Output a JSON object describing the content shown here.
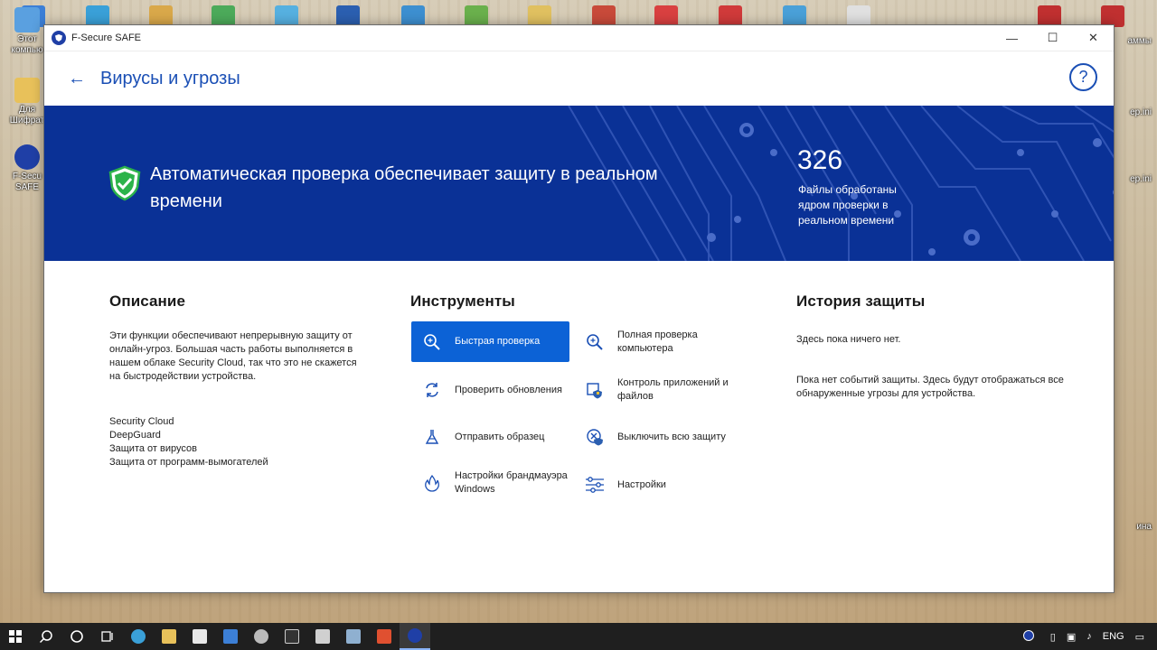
{
  "desktop": {
    "left_icons": [
      {
        "label": "Этот компью",
        "color": "#5aa0e0"
      },
      {
        "label": "Для Шифрат",
        "color": "#e8c15a"
      },
      {
        "label": "F-Secu SAFE",
        "color": "#1f3fa6"
      }
    ],
    "right_labels": [
      "аммы",
      "ep.ini",
      "ep.ini",
      "ина"
    ],
    "top_icon_colors": [
      "#3c7fd6",
      "#3aa0d8",
      "#d9a84a",
      "#4caa5a",
      "#56b0e0",
      "#2b5fb0",
      "#3d8fd0",
      "#6ab04c",
      "#e0c060",
      "#c84a3a",
      "#d94040",
      "#d03a3a",
      "#4aa0d8",
      "#e0e0e0",
      "#c03030"
    ]
  },
  "window": {
    "title": "F-Secure SAFE",
    "controls": {
      "minimize": "—",
      "maximize": "☐",
      "close": "✕"
    }
  },
  "header": {
    "back_icon": "←",
    "title": "Вирусы и угрозы",
    "help_icon": "?"
  },
  "banner": {
    "status_text": "Автоматическая проверка обеспечивает защиту в реальном времени",
    "stat_value": "326",
    "stat_label": "Файлы обработаны ядром проверки в реальном времени",
    "colors": {
      "background": "#0a3196",
      "shield": "#2cb34a"
    }
  },
  "description": {
    "title": "Описание",
    "text": "Эти функции обеспечивают непрерывную защиту от онлайн-угроз. Большая часть работы выполняется в нашем облаке Security Cloud, так что это не скажется на быстродействии устройства.",
    "features": [
      "Security Cloud",
      "DeepGuard",
      "Защита от вирусов",
      "Защита от программ-вымогателей"
    ]
  },
  "tools": {
    "title": "Инструменты",
    "items": [
      {
        "label": "Быстрая проверка",
        "icon": "quick-scan-icon"
      },
      {
        "label": "Полная проверка компьютера",
        "icon": "full-scan-icon"
      },
      {
        "label": "Проверить обновления",
        "icon": "refresh-icon"
      },
      {
        "label": "Контроль приложений и файлов",
        "icon": "app-control-icon"
      },
      {
        "label": "Отправить образец",
        "icon": "send-sample-icon"
      },
      {
        "label": "Выключить всю защиту",
        "icon": "disable-protection-icon"
      },
      {
        "label": "Настройки брандмауэра Windows",
        "icon": "firewall-icon"
      },
      {
        "label": "Настройки",
        "icon": "settings-sliders-icon"
      }
    ],
    "accent": "#0c62d6"
  },
  "history": {
    "title": "История защиты",
    "empty_text": "Здесь пока ничего нет.",
    "info_text": "Пока нет событий защиты. Здесь будут отображаться все обнаруженные угрозы для устройства."
  },
  "taskbar": {
    "language": "ENG",
    "app_colors": [
      "#3aa0d8",
      "#e8c15a",
      "#e8e8e8",
      "#3c7fd6",
      "#bbbbbb",
      "#333333",
      "#d0d0d0",
      "#8fb0d0",
      "#e05030",
      "#1f3fa6"
    ]
  }
}
